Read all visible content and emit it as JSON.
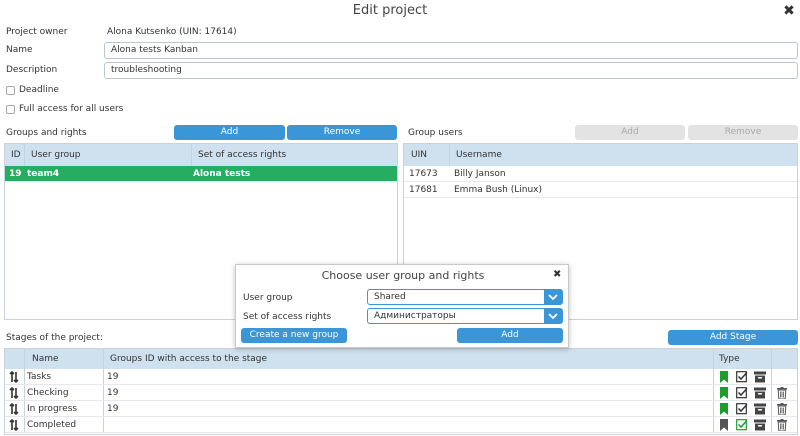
{
  "dialog": {
    "title": "Edit project"
  },
  "form": {
    "owner_label": "Project owner",
    "owner_value": "Alona Kutsenko (UIN: 17614)",
    "name_label": "Name",
    "name_value": "Alona tests Kanban",
    "description_label": "Description",
    "description_value": "troubleshooting",
    "deadline_label": "Deadline",
    "full_access_label": "Full access for all users"
  },
  "groups": {
    "title": "Groups and rights",
    "add_label": "Add",
    "remove_label": "Remove",
    "columns": [
      "ID",
      "User group",
      "Set of access rights"
    ],
    "rows": [
      {
        "id": "19",
        "group": "team4",
        "rights": "Alona tests"
      }
    ]
  },
  "group_users": {
    "title": "Group users",
    "add_label": "Add",
    "remove_label": "Remove",
    "columns": [
      "UIN",
      "Username"
    ],
    "rows": [
      {
        "uin": "17673",
        "name": "Billy Janson"
      },
      {
        "uin": "17681",
        "name": "Emma Bush (Linux)"
      }
    ]
  },
  "popup": {
    "title": "Choose user group and rights",
    "user_group_label": "User group",
    "user_group_value": "Shared",
    "rights_label": "Set of access rights",
    "rights_value": "Администраторы",
    "create_label": "Create a new group",
    "add_label": "Add"
  },
  "stages": {
    "title": "Stages of the project:",
    "add_stage_label": "Add Stage",
    "columns": [
      "Name",
      "Groups ID with access to the stage",
      "Type"
    ],
    "rows": [
      {
        "name": "Tasks",
        "groups": "19",
        "flag_color": "#1a9e2e",
        "deletable": false
      },
      {
        "name": "Checking",
        "groups": "19",
        "flag_color": "#1a9e2e",
        "deletable": true
      },
      {
        "name": "In progress",
        "groups": "19",
        "flag_color": "#1a9e2e",
        "deletable": true
      },
      {
        "name": "Completed",
        "groups": "",
        "flag_color": "#555555",
        "check_color": "#1a9e2e",
        "deletable": true
      }
    ]
  },
  "colors": {
    "accent": "#3a96d7",
    "selected_row": "#27ad60",
    "header": "#cfe0ee"
  }
}
